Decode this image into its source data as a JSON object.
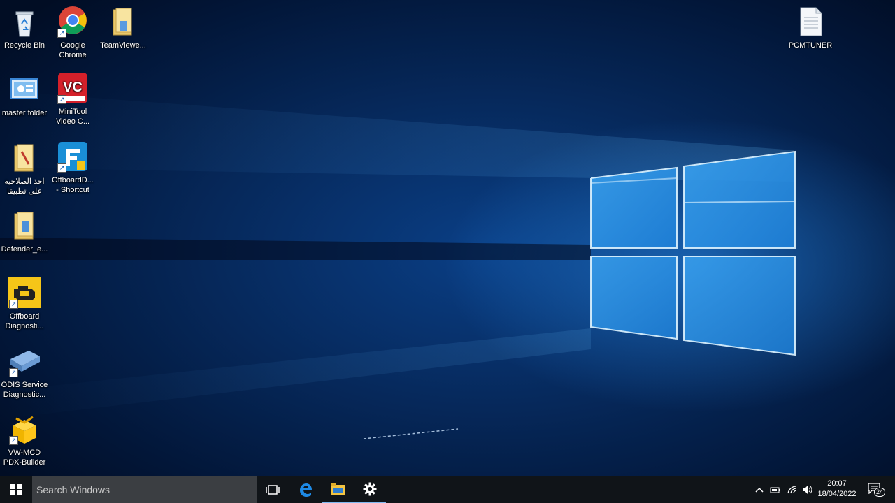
{
  "desktop": {
    "icons": [
      {
        "label": "Recycle Bin",
        "icon": "recycle-bin-icon"
      },
      {
        "label": "Google\nChrome",
        "icon": "chrome-icon"
      },
      {
        "label": "TeamViewe...",
        "icon": "folder-icon"
      },
      {
        "label": "PCMTUNER",
        "icon": "document-icon"
      },
      {
        "label": "master folder",
        "icon": "control-panel-icon"
      },
      {
        "label": "MiniTool\nVideo C...",
        "icon": "minitool-video-icon"
      },
      {
        "label": "اخذ الصلاحية\nعلى تطبيقا",
        "icon": "folder-icon"
      },
      {
        "label": "OffboardD...\n- Shortcut",
        "icon": "offboard-diagnostic-icon"
      },
      {
        "label": "Defender_e...",
        "icon": "folder-icon"
      },
      {
        "label": "Offboard\nDiagnosti...",
        "icon": "engine-check-icon"
      },
      {
        "label": "ODIS Service\nDiagnostic...",
        "icon": "vci-device-icon"
      },
      {
        "label": "VW-MCD\nPDX-Builder",
        "icon": "package-icon"
      }
    ],
    "mini_tool_badge": "VC"
  },
  "taskbar": {
    "search_placeholder": "Search Windows",
    "pinned": [
      "task-view-icon",
      "edge-icon",
      "file-explorer-icon",
      "settings-icon"
    ],
    "clock_time": "20:07",
    "clock_date": "18/04/2022",
    "notification_count": "24"
  },
  "colors": {
    "taskbar_bg": "#101418",
    "search_bg": "#3b3e42",
    "accent": "#0a7ad8"
  }
}
